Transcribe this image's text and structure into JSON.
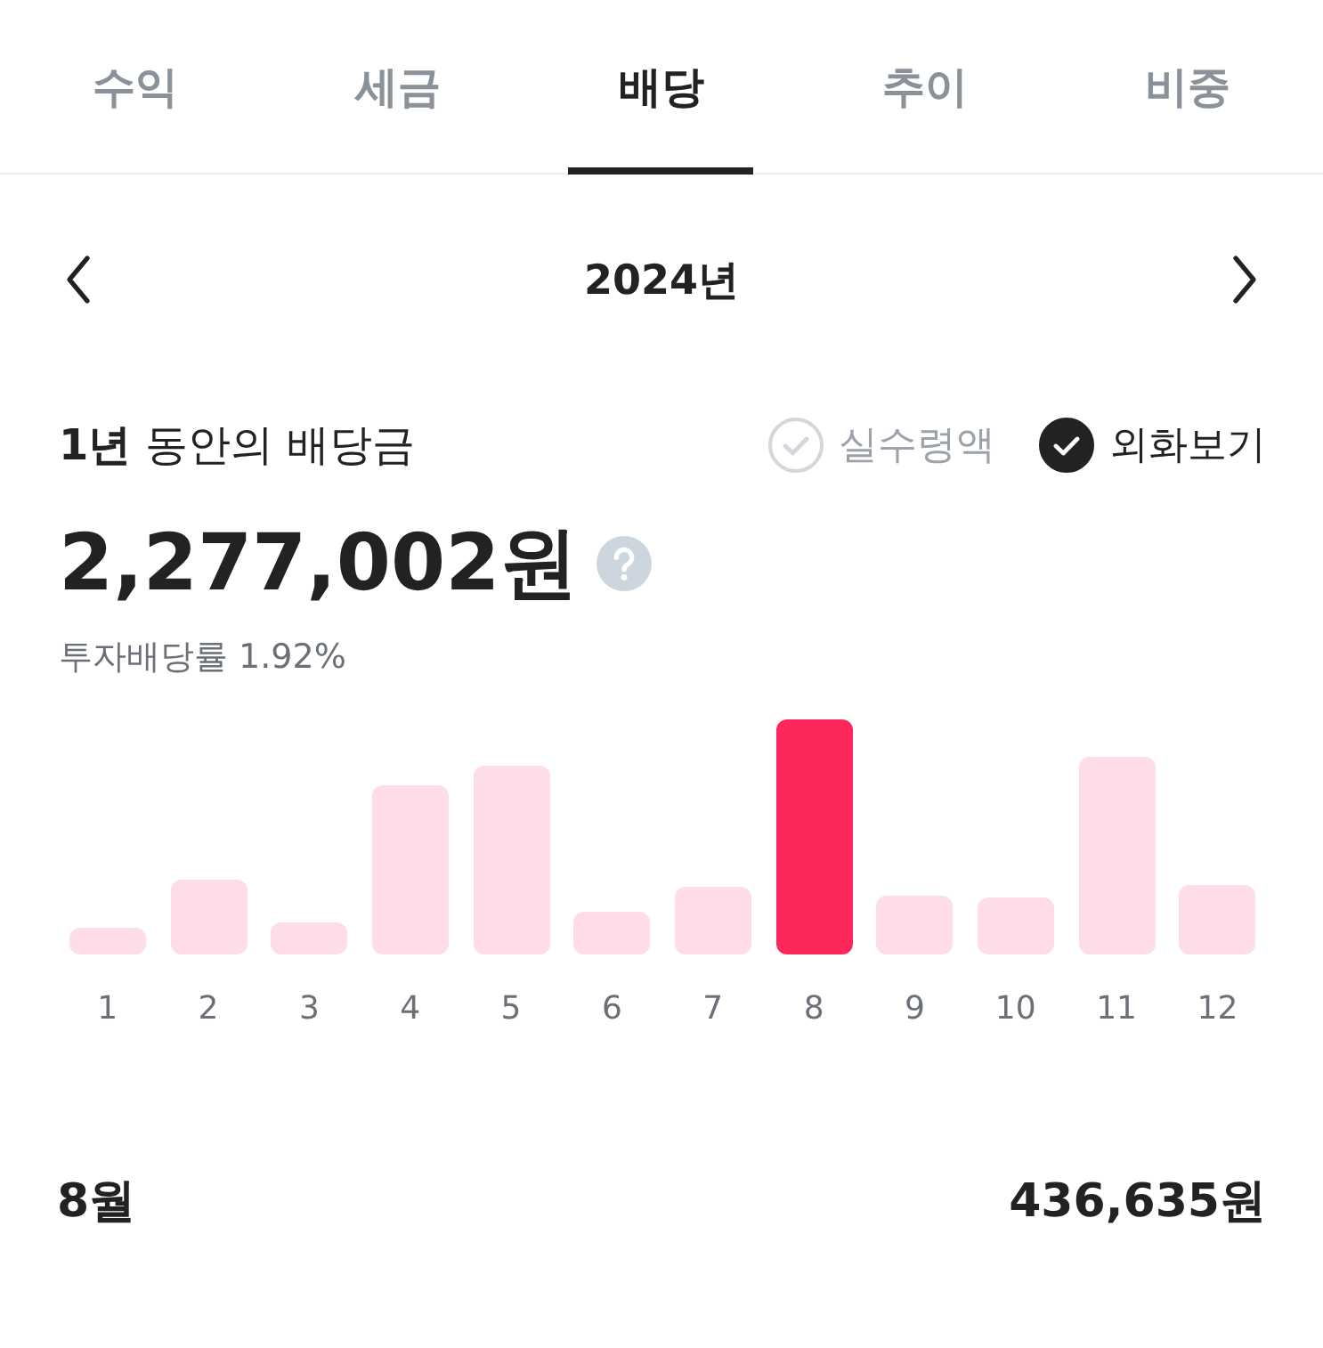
{
  "tabs": [
    {
      "label": "수익",
      "selected": false
    },
    {
      "label": "세금",
      "selected": false
    },
    {
      "label": "배당",
      "selected": true
    },
    {
      "label": "추이",
      "selected": false
    },
    {
      "label": "비중",
      "selected": false
    }
  ],
  "year": "2024년",
  "title": {
    "strong": "1년",
    "rest": "동안의 배당금"
  },
  "options": [
    {
      "label": "실수령액",
      "checked": false
    },
    {
      "label": "외화보기",
      "checked": true
    }
  ],
  "total": "2,277,002원",
  "yield": "투자배당률 1.92%",
  "months": [
    {
      "label": "1",
      "selected": false
    },
    {
      "label": "2",
      "selected": false
    },
    {
      "label": "3",
      "selected": false
    },
    {
      "label": "4",
      "selected": false
    },
    {
      "label": "5",
      "selected": false
    },
    {
      "label": "6",
      "selected": false
    },
    {
      "label": "7",
      "selected": false
    },
    {
      "label": "8",
      "selected": true
    },
    {
      "label": "9",
      "selected": false
    },
    {
      "label": "10",
      "selected": false
    },
    {
      "label": "11",
      "selected": false
    },
    {
      "label": "12",
      "selected": false
    }
  ],
  "detail": {
    "month": "8월",
    "amount": "436,635원"
  }
}
